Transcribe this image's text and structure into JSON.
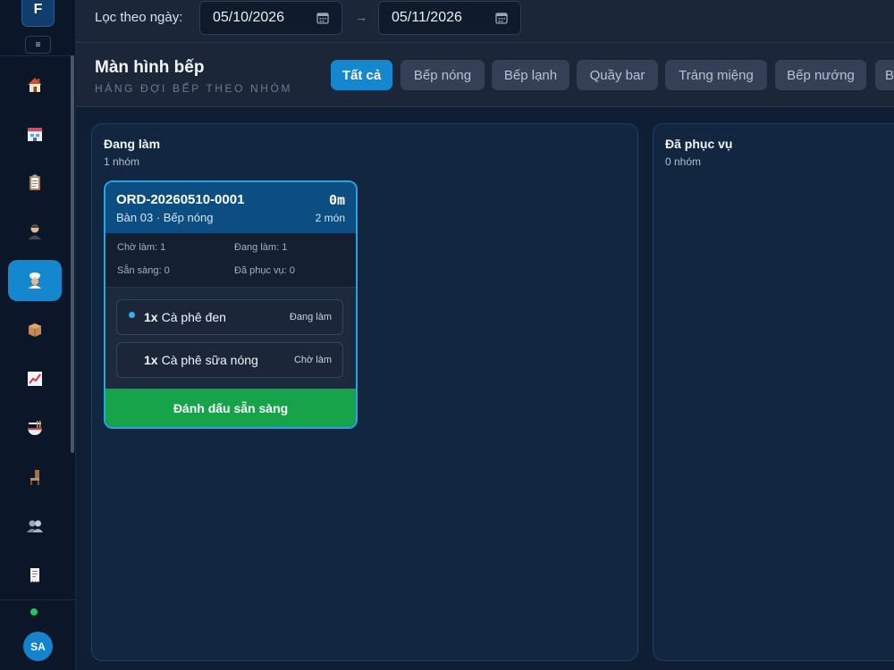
{
  "sidebar": {
    "brand": "F",
    "collapse": "≡",
    "items": [
      {
        "icon": "home-icon",
        "glyph": "🏠",
        "active": false
      },
      {
        "icon": "store-icon",
        "glyph": "🏪",
        "active": false
      },
      {
        "icon": "clipboard-icon",
        "glyph": "📋",
        "active": false
      },
      {
        "icon": "waiter-icon",
        "glyph": "🧑",
        "active": false
      },
      {
        "icon": "chef-icon",
        "glyph": "🧑‍🍳",
        "active": true
      },
      {
        "icon": "package-icon",
        "glyph": "📦",
        "active": false
      },
      {
        "icon": "chart-icon",
        "glyph": "📈",
        "active": false
      },
      {
        "icon": "noodle-icon",
        "glyph": "🍜",
        "active": false
      },
      {
        "icon": "chair-icon",
        "glyph": "🪑",
        "active": false
      },
      {
        "icon": "users-icon",
        "glyph": "👥",
        "active": false
      },
      {
        "icon": "receipt-icon",
        "glyph": "🧾",
        "active": false
      }
    ],
    "avatar": "SA"
  },
  "filter": {
    "label": "Lọc theo ngày:",
    "from": "05/10/2026",
    "to": "05/11/2026",
    "arrow": "→"
  },
  "header": {
    "title": "Màn hình bếp",
    "subtitle": "HÀNG ĐỢI BẾP THEO NHÓM",
    "tabs": [
      "Tất cả",
      "Bếp nóng",
      "Bếp lạnh",
      "Quầy bar",
      "Tráng miệng",
      "Bếp nướng",
      "B"
    ]
  },
  "columns": {
    "in_progress": {
      "title": "Đang làm",
      "count": "1 nhóm"
    },
    "served": {
      "title": "Đã phục vụ",
      "count": "0 nhóm"
    }
  },
  "order": {
    "id": "ORD-20260510-0001",
    "elapsed": "0m",
    "location": "Bàn 03 · Bếp nóng",
    "item_count": "2 món",
    "stats": {
      "waiting": "Chờ làm: 1",
      "in_progress": "Đang làm: 1",
      "ready": "Sẵn sàng: 0",
      "served": "Đã phục vụ: 0"
    },
    "items": [
      {
        "qty": "1x",
        "name": "Cà phê đen",
        "status": "Đang làm"
      },
      {
        "qty": "1x",
        "name": "Cà phê sữa nóng",
        "status": "Chờ làm"
      }
    ],
    "action": "Đánh dấu sẵn sàng"
  }
}
